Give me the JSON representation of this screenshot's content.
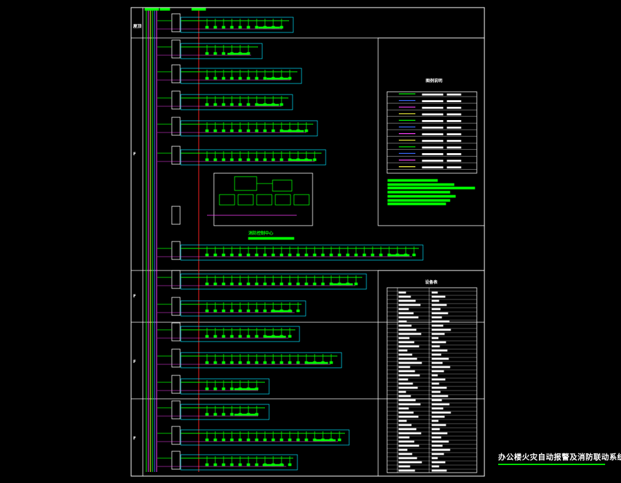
{
  "title": {
    "text": "办公楼火灾自动报警及消防联动系统图(一)"
  },
  "floor_labels": [
    "屋顶",
    "F",
    "F",
    "F",
    "F"
  ],
  "center_label": "消防控制中心",
  "legend_titles": [
    "图例说明",
    "设备表"
  ],
  "colors": {
    "background": "#000000",
    "frame": "#ffffff",
    "device": "#00ff00",
    "panel": "#00e5ff",
    "bus_red": "#ff2020",
    "bus_magenta": "#ff40ff",
    "bus_blue": "#3a6bff",
    "bus_yellow": "#ffff40"
  }
}
